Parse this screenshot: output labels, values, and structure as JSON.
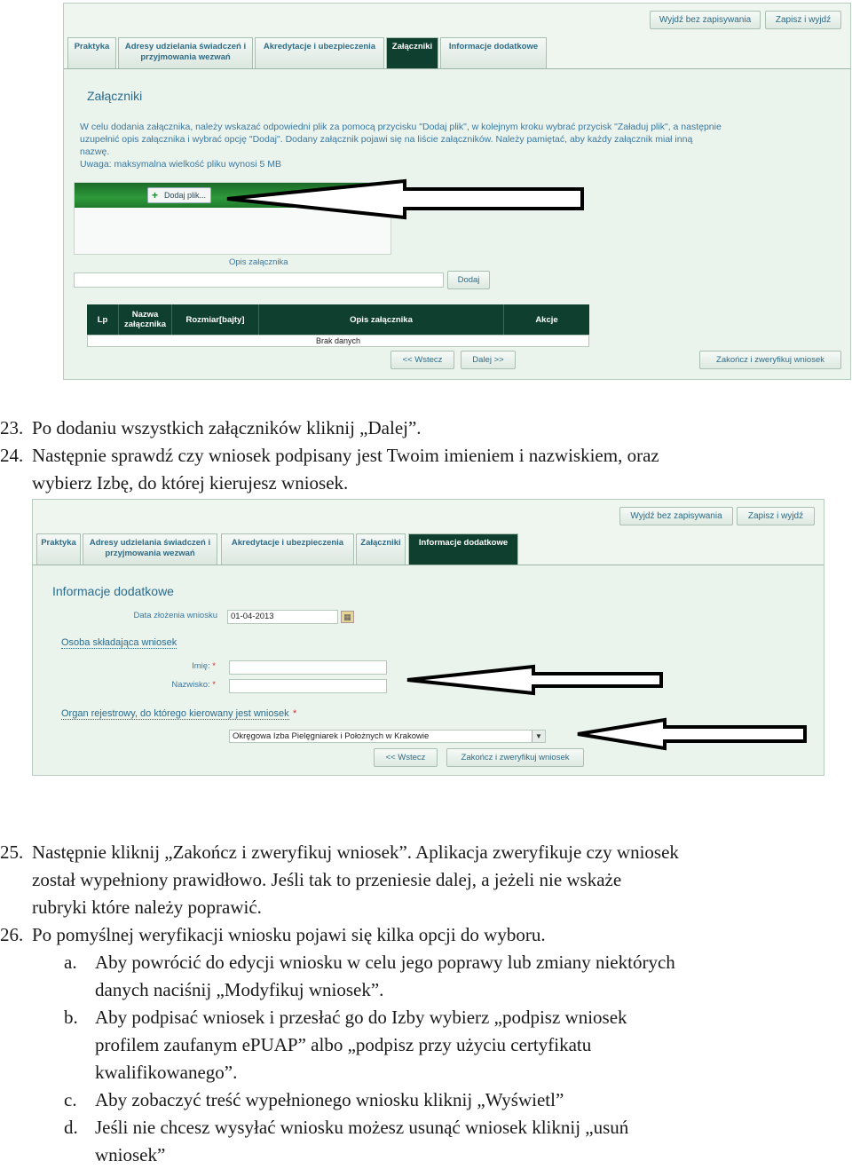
{
  "shot1": {
    "top_buttons": [
      "Wyjdź bez zapisywania",
      "Zapisz i wyjdź"
    ],
    "tabs": [
      "Praktyka",
      "Adresy udzielania świadczeń i przyjmowania wezwań",
      "Akredytacje i ubezpieczenia",
      "Załączniki",
      "Informacje dodatkowe"
    ],
    "active_tab": "Załączniki",
    "title": "Załączniki",
    "info_lines": [
      "W celu dodania załącznika, należy wskazać odpowiedni plik za pomocą przycisku \"Dodaj plik\", w kolejnym kroku wybrać przycisk \"Załaduj plik\", a następnie",
      "uzupełnić opis załącznika i wybrać opcję \"Dodaj\". Dodany załącznik pojawi się na liście załączników. Należy pamiętać, aby każdy załącznik miał inną",
      "nazwę.",
      "Uwaga: maksymalna wielkość pliku wynosi 5 MB"
    ],
    "add_file_label": "Dodaj plik...",
    "description_label": "Opis załącznika",
    "add_button": "Dodaj",
    "table": {
      "headers": [
        "Lp",
        "Nazwa załącznika",
        "Rozmiar[bajty]",
        "Opis załącznika",
        "Akcje"
      ],
      "empty_text": "Brak danych"
    },
    "nav_buttons": [
      "<< Wstecz",
      "Dalej >>"
    ],
    "finish_button": "Zakończ i zweryfikuj wniosek"
  },
  "doc1": [
    {
      "num": "23.",
      "text": "Po dodaniu wszystkich załączników kliknij „Dalej”."
    },
    {
      "num": "24.",
      "text": "Następnie sprawdź czy wniosek podpisany jest Twoim imieniem i nazwiskiem, oraz",
      "cont": "wybierz Izbę, do której kierujesz wniosek."
    }
  ],
  "shot2": {
    "top_buttons": [
      "Wyjdź bez zapisywania",
      "Zapisz i wyjdź"
    ],
    "tabs": [
      "Praktyka",
      "Adresy udzielania świadczeń i przyjmowania wezwań",
      "Akredytacje i ubezpieczenia",
      "Załączniki",
      "Informacje dodatkowe"
    ],
    "active_tab": "Informacje dodatkowe",
    "title": "Informacje dodatkowe",
    "date_label": "Data złożenia wniosku",
    "date_value": "01-04-2013",
    "person_section": "Osoba składająca wniosek",
    "first_name_label": "Imię:",
    "last_name_label": "Nazwisko:",
    "organ_section": "Organ rejestrowy, do którego kierowany jest wniosek",
    "organ_value": "Okręgowa Izba Pielęgniarek i Położnych w Krakowie",
    "back_button": "<< Wstecz",
    "finish_button": "Zakończ i zweryfikuj wniosek",
    "required_mark": "*"
  },
  "doc2": {
    "p25_num": "25.",
    "p25_lines": [
      "Następnie kliknij „Zakończ i zweryfikuj wniosek”. Aplikacja zweryfikuje czy wniosek",
      "został wypełniony prawidłowo. Jeśli tak to przeniesie dalej, a jeżeli nie wskaże",
      "rubryki które należy poprawić."
    ],
    "p26_num": "26.",
    "p26_text": "Po pomyślnej weryfikacji wniosku pojawi się kilka opcji do wyboru.",
    "items": [
      {
        "letter": "a.",
        "lines": [
          "Aby powrócić do edycji wniosku w celu jego poprawy lub zmiany niektórych",
          "danych naciśnij „Modyfikuj wniosek”."
        ]
      },
      {
        "letter": "b.",
        "lines": [
          "Aby podpisać wniosek i przesłać go do Izby wybierz „podpisz wniosek",
          "profilem zaufanym ePUAP” albo „podpisz przy użyciu certyfikatu",
          "kwalifikowanego”."
        ]
      },
      {
        "letter": "c.",
        "lines": [
          "Aby zobaczyć treść wypełnionego wniosku kliknij „Wyświetl”"
        ]
      },
      {
        "letter": "d.",
        "lines": [
          "Jeśli nie chcesz wysyłać wniosku możesz usunąć wniosek kliknij „usuń",
          "wniosek”"
        ]
      }
    ]
  }
}
